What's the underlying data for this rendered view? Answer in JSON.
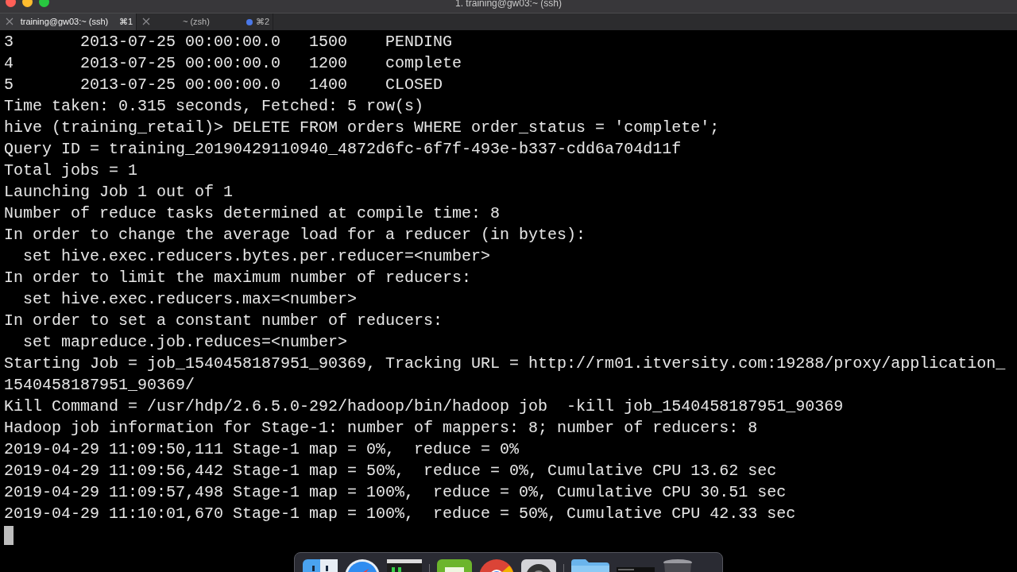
{
  "window": {
    "title": "1. training@gw03:~ (ssh)"
  },
  "tabs": [
    {
      "label": "training@gw03:~ (ssh)",
      "shortcut": "⌘1",
      "selected": true,
      "activity": false
    },
    {
      "label": "~ (zsh)",
      "shortcut": "⌘2",
      "selected": false,
      "activity": true
    }
  ],
  "terminal": {
    "lines": [
      "3       2013-07-25 00:00:00.0   1500    PENDING",
      "4       2013-07-25 00:00:00.0   1200    complete",
      "5       2013-07-25 00:00:00.0   1400    CLOSED",
      "Time taken: 0.315 seconds, Fetched: 5 row(s)",
      "hive (training_retail)> DELETE FROM orders WHERE order_status = 'complete';",
      "Query ID = training_20190429110940_4872d6fc-6f7f-493e-b337-cdd6a704d11f",
      "Total jobs = 1",
      "Launching Job 1 out of 1",
      "Number of reduce tasks determined at compile time: 8",
      "In order to change the average load for a reducer (in bytes):",
      "  set hive.exec.reducers.bytes.per.reducer=<number>",
      "In order to limit the maximum number of reducers:",
      "  set hive.exec.reducers.max=<number>",
      "In order to set a constant number of reducers:",
      "  set mapreduce.job.reduces=<number>",
      "Starting Job = job_1540458187951_90369, Tracking URL = http://rm01.itversity.com:19288/proxy/application_",
      "1540458187951_90369/",
      "Kill Command = /usr/hdp/2.6.5.0-292/hadoop/bin/hadoop job  -kill job_1540458187951_90369",
      "Hadoop job information for Stage-1: number of mappers: 8; number of reducers: 8",
      "2019-04-29 11:09:50,111 Stage-1 map = 0%,  reduce = 0%",
      "2019-04-29 11:09:56,442 Stage-1 map = 50%,  reduce = 0%, Cumulative CPU 13.62 sec",
      "2019-04-29 11:09:57,498 Stage-1 map = 100%,  reduce = 0%, Cumulative CPU 30.51 sec",
      "2019-04-29 11:10:01,670 Stage-1 map = 100%,  reduce = 50%, Cumulative CPU 42.33 sec"
    ],
    "cursor": true
  }
}
